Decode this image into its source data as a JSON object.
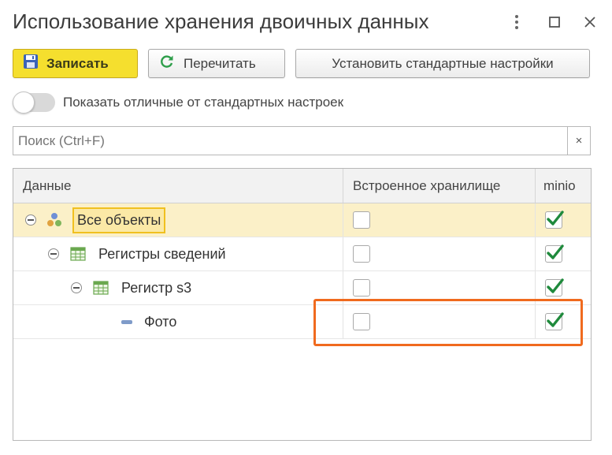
{
  "window": {
    "title": "Использование хранения двоичных данных"
  },
  "toolbar": {
    "save_label": "Записать",
    "reread_label": "Перечитать",
    "default_label": "Установить стандартные настройки"
  },
  "toggle": {
    "label": "Показать отличные от стандартных настроек",
    "on": false
  },
  "search": {
    "placeholder": "Поиск (Ctrl+F)",
    "value": "",
    "clear_label": "×"
  },
  "table": {
    "columns": [
      "Данные",
      "Встроенное хранилище",
      "minio"
    ],
    "rows": [
      {
        "label": "Все объекты",
        "icon": "all-objects-icon",
        "builtin": false,
        "minio": true
      },
      {
        "label": "Регистры сведений",
        "icon": "register-group-icon",
        "builtin": false,
        "minio": true
      },
      {
        "label": "Регистр s3",
        "icon": "register-icon",
        "builtin": false,
        "minio": true
      },
      {
        "label": "Фото",
        "icon": "attribute-icon",
        "builtin": false,
        "minio": true
      }
    ]
  },
  "colors": {
    "save_button": "#f5df2e",
    "selected_row": "#fbf0c8",
    "check": "#1f8a3c",
    "annotation": "#f06a1e"
  }
}
